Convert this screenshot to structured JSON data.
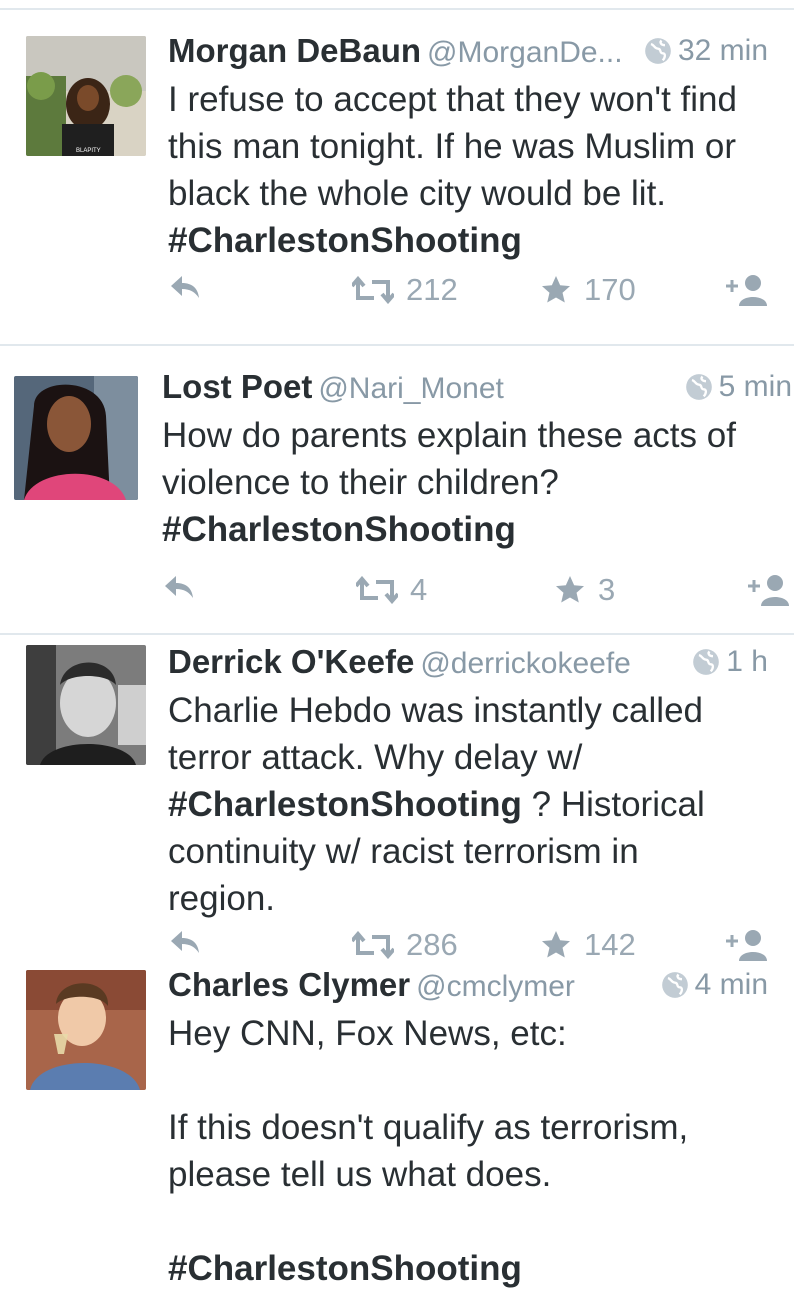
{
  "tweets": [
    {
      "name": "Morgan DeBaun",
      "handle": "@MorganDe...",
      "time": "32 min",
      "text": "I refuse to accept that they won't find this man tonight. If he was Muslim or black the whole city would be lit.",
      "hashtag": "#CharlestonShooting",
      "retweets": "212",
      "favorites": "170",
      "avatar_shirt_text": "BLAPITY"
    },
    {
      "name": "Lost Poet",
      "handle": "@Nari_Monet",
      "time": "5 min",
      "text": "How do parents explain these acts of violence to their children?",
      "hashtag": "#CharlestonShooting",
      "retweets": "4",
      "favorites": "3"
    },
    {
      "name": "Derrick O'Keefe",
      "handle": "@derrickokeefe",
      "time": "1 h",
      "text_before": "Charlie Hebdo was instantly called terror attack. Why delay w/",
      "hashtag": "#CharlestonShooting",
      "text_after": " ? Historical continuity w/ racist terrorism in region.",
      "retweets": "286",
      "favorites": "142"
    },
    {
      "name": "Charles Clymer",
      "handle": "@cmclymer",
      "time": "4 min",
      "text": "Hey CNN, Fox News, etc:\n\nIf this doesn't qualify as terrorism, please tell us what does.",
      "hashtag": "#CharlestonShooting"
    }
  ],
  "icons": {
    "reply": "reply-icon",
    "retweet": "retweet-icon",
    "favorite": "star-icon",
    "follow": "follow-user-icon",
    "globe": "globe-icon"
  },
  "colors": {
    "muted": "#8899a6",
    "icon": "#9aa8b3",
    "divider": "#e1e8ed"
  }
}
